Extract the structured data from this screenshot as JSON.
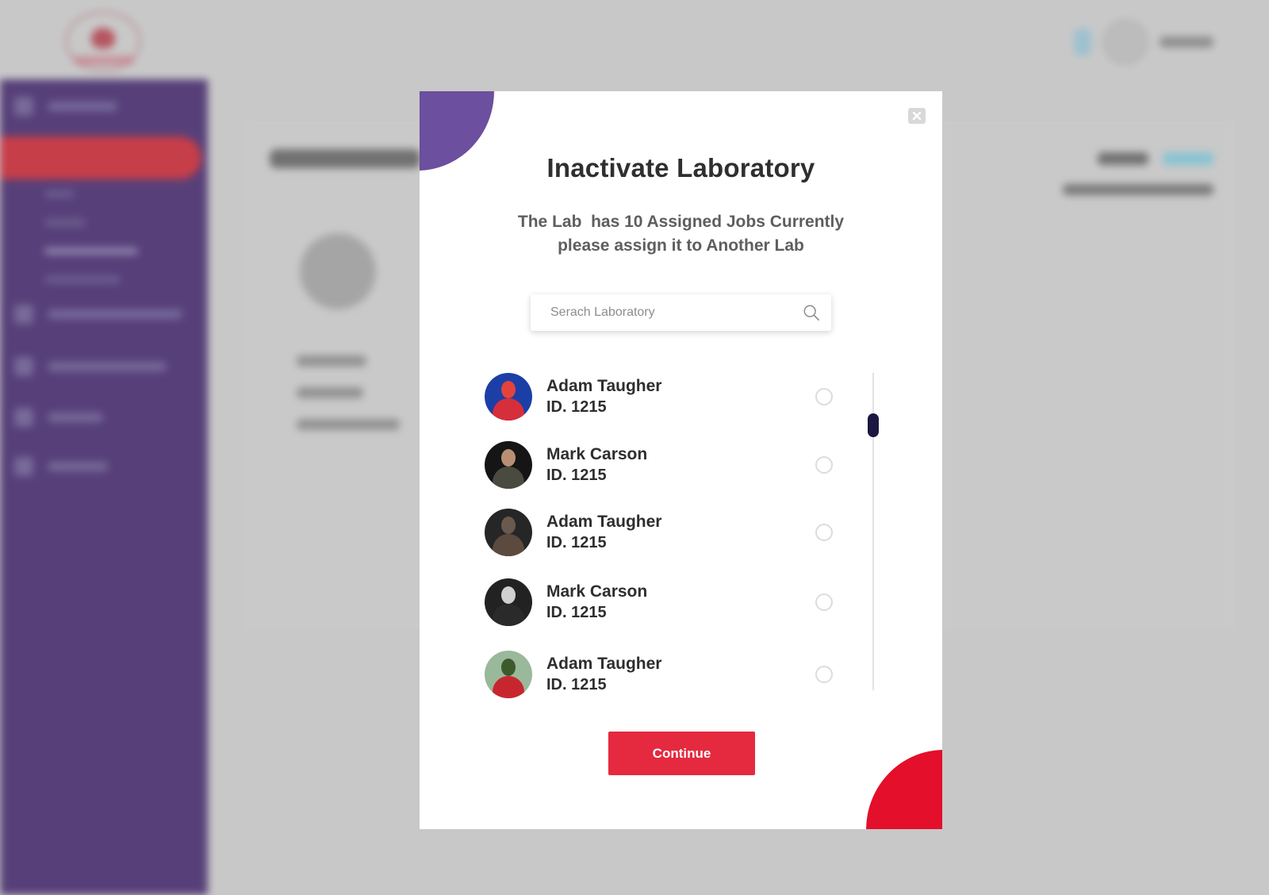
{
  "modal": {
    "title": "Inactivate Laboratory",
    "description_line1": "The Lab  has 10 Assigned Jobs Currently",
    "description_line2": "please assign it to Another Lab",
    "search_placeholder": "Serach Laboratory",
    "search_value": "",
    "continue_label": "Continue",
    "close_icon": "close-icon",
    "search_icon": "search-icon"
  },
  "labs": [
    {
      "name": "Adam Taugher",
      "id": "ID. 1215",
      "selected": false
    },
    {
      "name": "Mark Carson",
      "id": "ID. 1215",
      "selected": false
    },
    {
      "name": "Adam Taugher",
      "id": "ID. 1215",
      "selected": false
    },
    {
      "name": "Mark Carson",
      "id": "ID. 1215",
      "selected": false
    },
    {
      "name": "Adam Taugher",
      "id": "ID. 1215",
      "selected": false
    }
  ],
  "colors": {
    "sidebar": "#32135f",
    "accent_red": "#e5293f",
    "accent_purple": "#6c4f9e",
    "scroll_thumb": "#1b1742"
  }
}
